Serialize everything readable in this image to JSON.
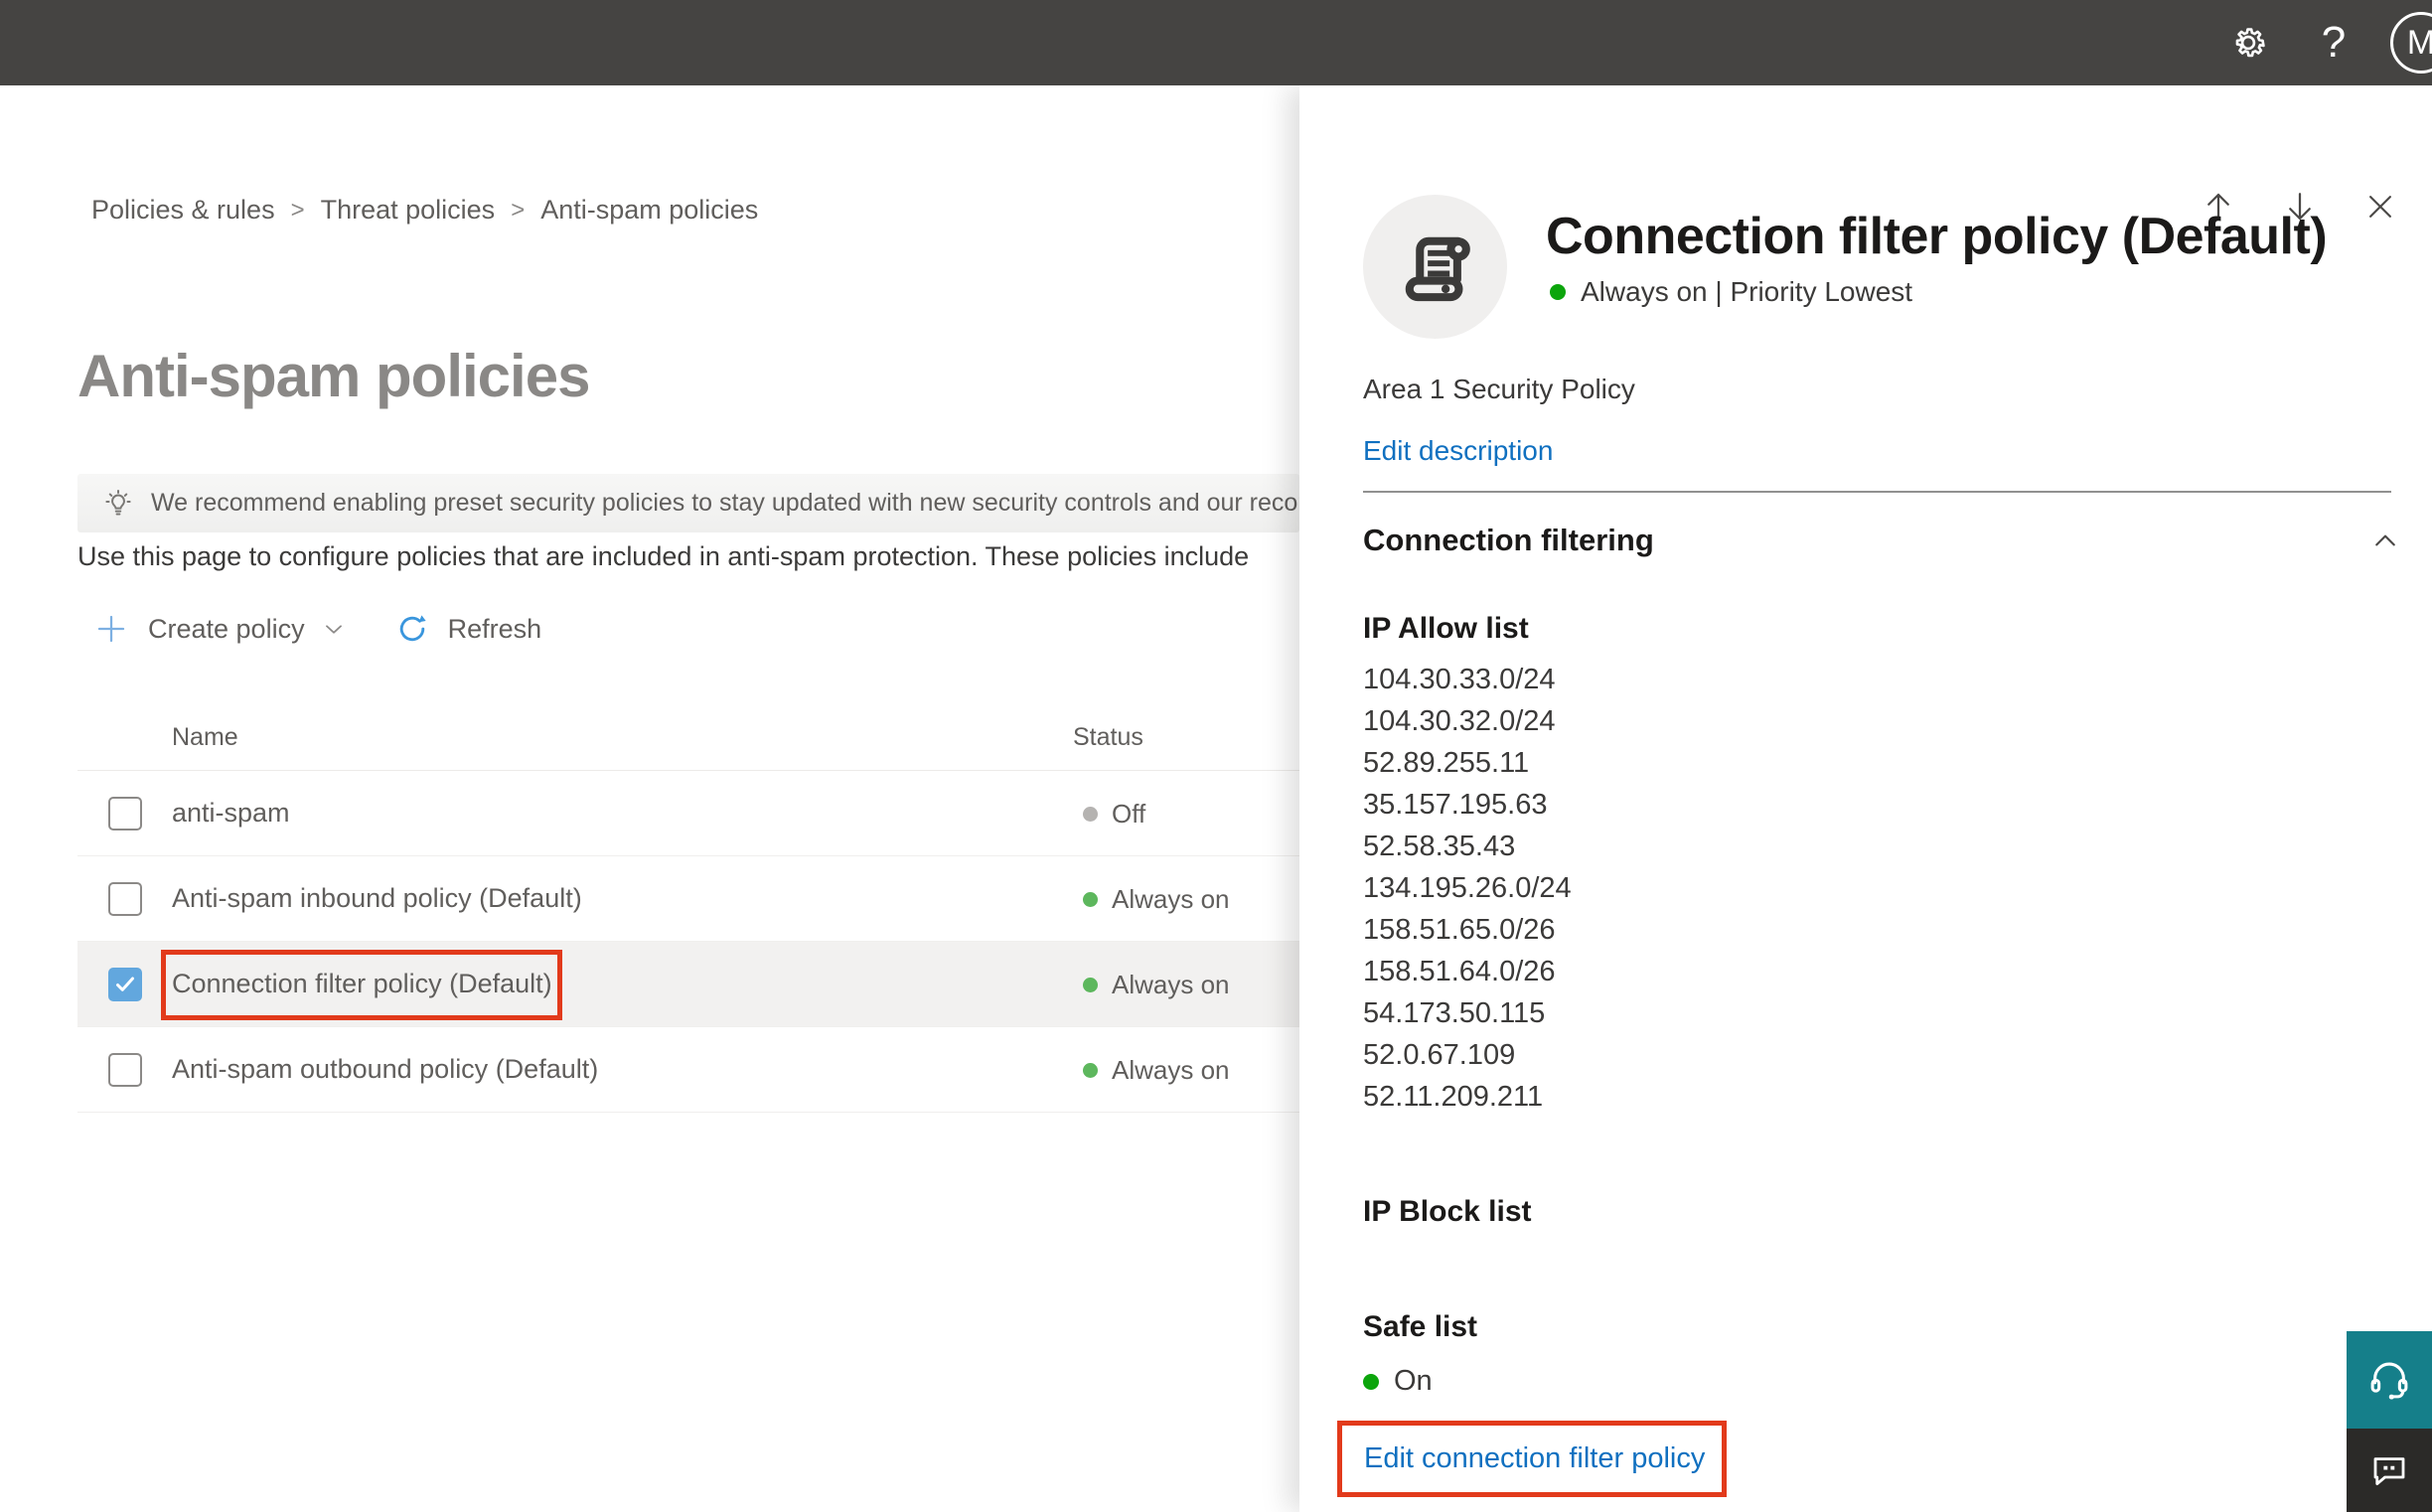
{
  "colors": {
    "topbar_bg": "#454442",
    "link_blue": "#1070c0",
    "plus_blue": "#7db0e2",
    "refresh_blue": "#3a96dd",
    "checkbox_blue": "#62a7de",
    "green_bright": "#0ca50c",
    "green_soft": "#5db75d",
    "gray_off": "#b5b3b1",
    "annotation_red": "#e23a1b",
    "teal_button": "#157f8a",
    "dark_button": "#2b2a28"
  },
  "topbar": {
    "avatar_initial": "M"
  },
  "breadcrumb": {
    "separator": ">",
    "items": [
      "Policies & rules",
      "Threat policies",
      "Anti-spam policies"
    ]
  },
  "page": {
    "title": "Anti-spam policies",
    "banner": {
      "text": "We recommend enabling preset security policies to stay updated with new security controls and our recomme"
    },
    "description": "Use this page to configure policies that are included in anti-spam protection. These policies include",
    "toolbar": {
      "create_policy": "Create policy",
      "refresh": "Refresh"
    },
    "table": {
      "columns": [
        "Name",
        "Status"
      ],
      "rows": [
        {
          "name": "anti-spam",
          "status": "Off",
          "status_color": "#b5b3b1",
          "checked": false,
          "selected": false,
          "annotated": false
        },
        {
          "name": "Anti-spam inbound policy (Default)",
          "status": "Always on",
          "status_color": "#5db75d",
          "checked": false,
          "selected": false,
          "annotated": false
        },
        {
          "name": "Connection filter policy (Default)",
          "status": "Always on",
          "status_color": "#5db75d",
          "checked": true,
          "selected": true,
          "annotated": true
        },
        {
          "name": "Anti-spam outbound policy (Default)",
          "status": "Always on",
          "status_color": "#5db75d",
          "checked": false,
          "selected": false,
          "annotated": false
        }
      ]
    }
  },
  "flyout": {
    "title": "Connection filter policy (Default)",
    "status_text": "Always on | Priority Lowest",
    "description": "Area 1 Security Policy",
    "edit_description": "Edit description",
    "section": "Connection filtering",
    "ip_allow": {
      "title": "IP Allow list",
      "ips": [
        "104.30.33.0/24",
        "104.30.32.0/24",
        "52.89.255.11",
        "35.157.195.63",
        "52.58.35.43",
        "134.195.26.0/24",
        "158.51.65.0/26",
        "158.51.64.0/26",
        "54.173.50.115",
        "52.0.67.109",
        "52.11.209.211"
      ]
    },
    "ip_block_title": "IP Block list",
    "safe_list": {
      "title": "Safe list",
      "status": "On"
    },
    "edit_link": "Edit connection filter policy"
  }
}
